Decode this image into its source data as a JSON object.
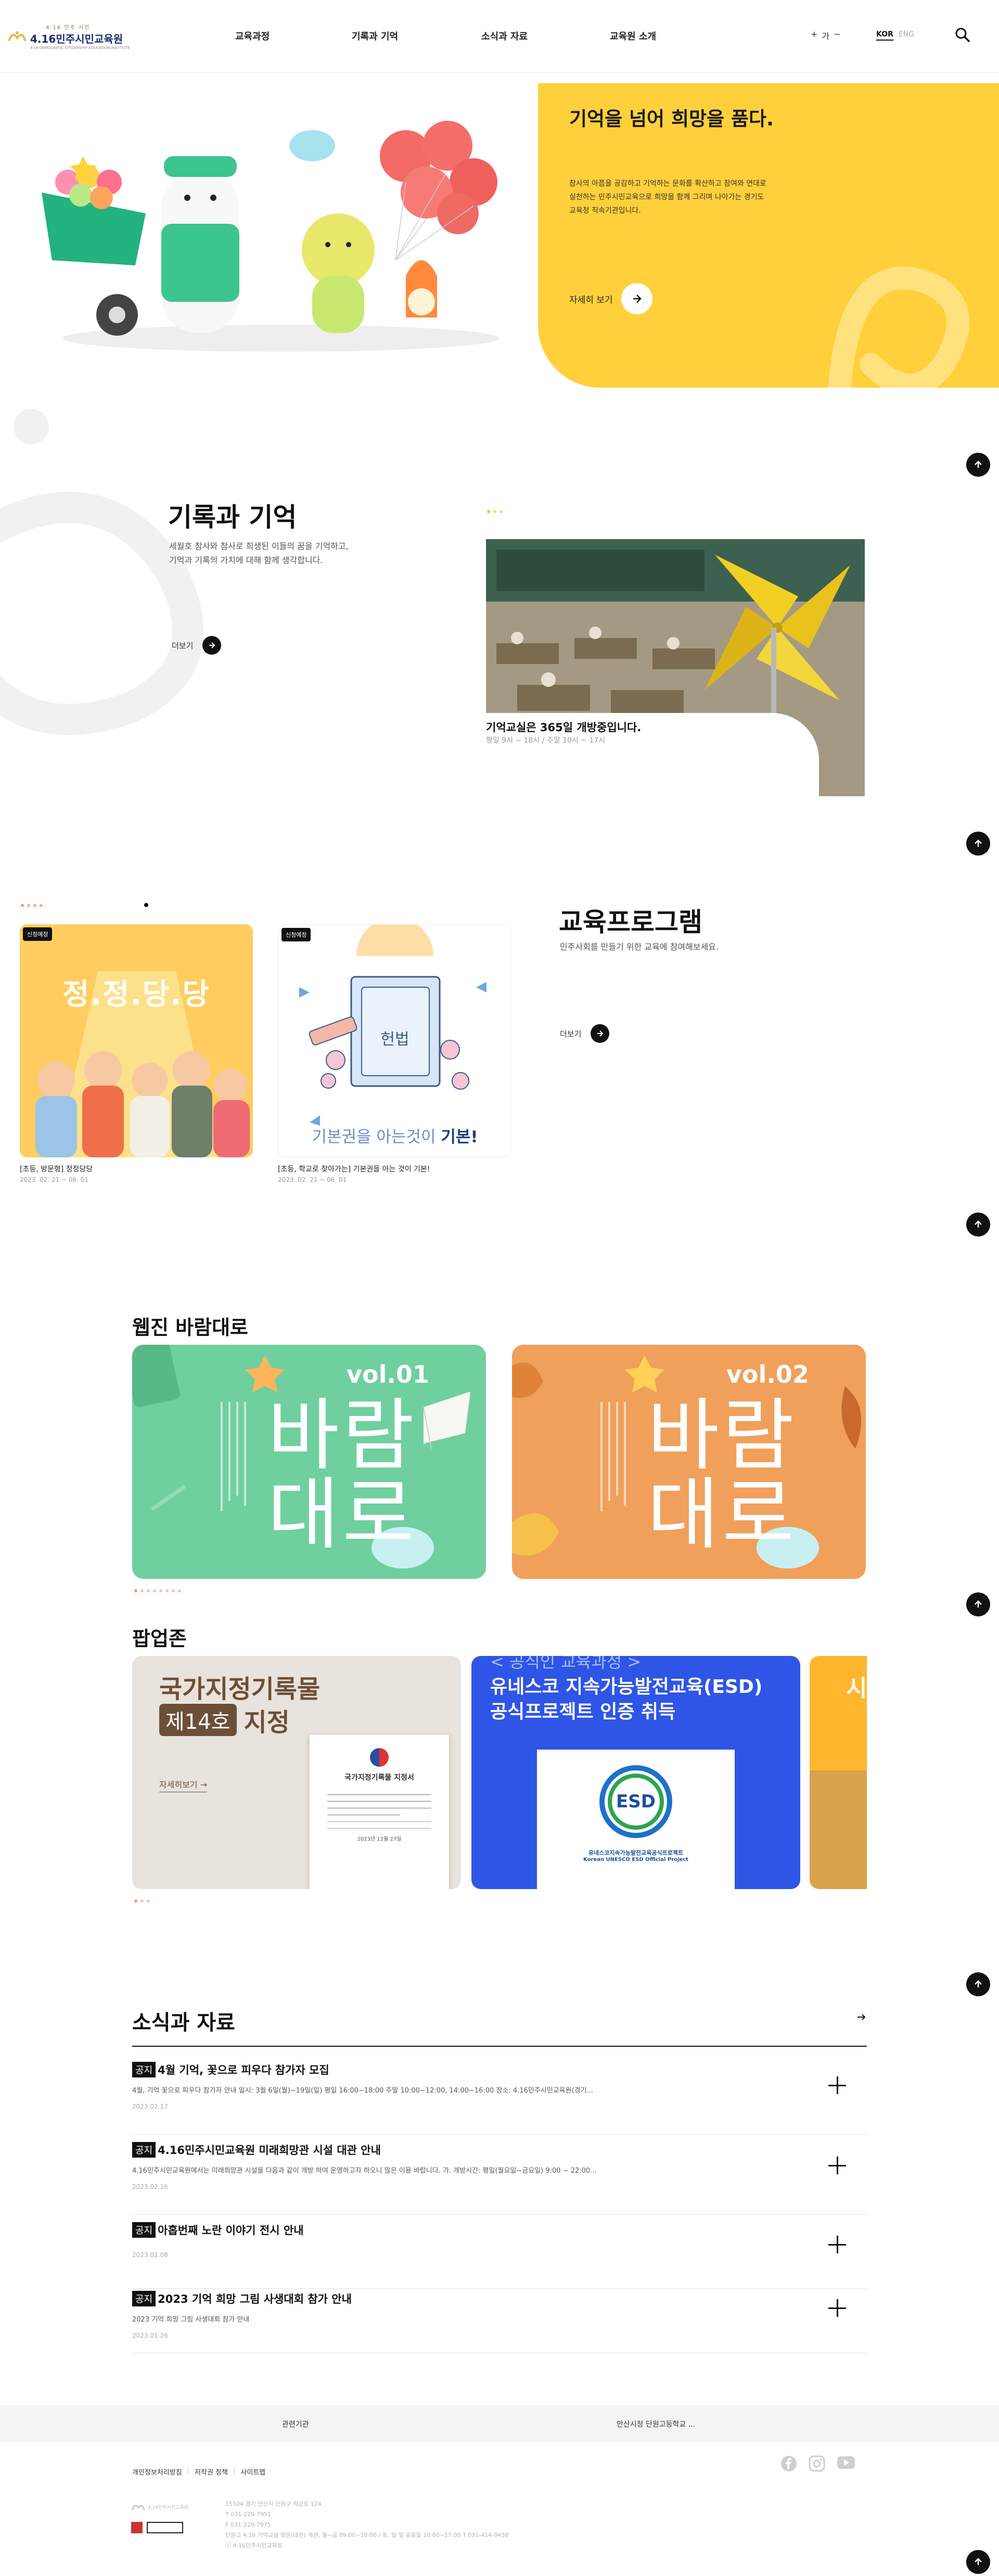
{
  "header": {
    "logo_sub": "4·16 민주 시민",
    "logo_main": "4.16민주시민교육원",
    "logo_en": "4.16 DEMOCRATIC CITIZENSHIP EDUCATION INSTITUTE",
    "nav": [
      "교육과정",
      "기록과 기억",
      "소식과 자료",
      "교육원 소개"
    ],
    "font_plus": "+",
    "font_label": "가",
    "font_minus": "−",
    "lang_kor": "KOR",
    "lang_eng": "ENG"
  },
  "hero": {
    "title": "기억을 넘어 희망을 품다.",
    "desc": "참사의 아픔을 공감하고 기억하는 문화를 확산하고 참여와 연대로 실천하는 민주시민교육으로 희망을 함께 그리며 나아가는 경기도교육청 직속기관입니다.",
    "more": "자세히 보기"
  },
  "memory": {
    "title": "기록과 기억",
    "desc1": "세월호 참사와 참사로 희생된 이들의 꿈을 기억하고,",
    "desc2": "기억과 기록의 가치에 대해 함께 생각합니다.",
    "more": "더보기",
    "caption_title": "기억교실은 365일 개방중입니다.",
    "caption_sub": "평일 9시 ~ 18시 / 주말 10시 ~ 17시"
  },
  "program": {
    "title": "교육프로그램",
    "desc": "민주사회를 만들기 위한 교육에 참여해보세요.",
    "more": "더보기",
    "cards": [
      {
        "badge": "신청예정",
        "art_title": "정.정.당.당",
        "title": "[초등, 방문형] 정정당당",
        "date": "2023. 02. 21 ~ 06. 01"
      },
      {
        "badge": "신청예정",
        "art_book": "헌법",
        "art_line": "기본권을 아는것이",
        "art_strong": "기본!",
        "title": "[초등, 학교로 찾아가는] 기본권을 아는 것이 기본!",
        "date": "2023. 02. 21 ~ 06. 01"
      }
    ]
  },
  "webzine": {
    "title": "웹진 바람대로",
    "cards": [
      {
        "vol": "vol.01",
        "line1": "바람",
        "line2": "대로",
        "color": "#6fcf9f"
      },
      {
        "vol": "vol.02",
        "line1": "바람",
        "line2": "대로",
        "color": "#f0a05a"
      }
    ]
  },
  "popup": {
    "title": "팝업존",
    "card1": {
      "line1": "국가지정기록물",
      "box": "제14호",
      "line2": "지정",
      "more": "자세히보기",
      "doc_title": "국가지정기록물 지정서",
      "doc_date": "2023년 12월 27일"
    },
    "card2": {
      "line0": "< 공식인 교육과정 >",
      "line1": "유네스코 지속가능발전교육(ESD)",
      "line2": "공식프로젝트 인증 취득",
      "esd": "ESD",
      "cert1": "유네스코지속가능발전교육공식프로젝트",
      "cert2": "Korean UNESCO ESD Official Project"
    },
    "card3": {
      "text": "시"
    }
  },
  "news": {
    "title": "소식과 자료",
    "items": [
      {
        "tag": "공지",
        "title": "4월 기억, 꽃으로 피우다 참가자 모집",
        "desc": "4월, 기억 꽃으로 피우다 참가자 안내 일시: 3월 6일(월)~19일(일)          평일 16:00~18:00          주말 10:00~12:00, 14:00~16:00 장소: 4.16민주시민교육원(경기...",
        "date": "2023.02.17"
      },
      {
        "tag": "공지",
        "title": "4.16민주시민교육원 미래희망관 시설 대관 안내",
        "desc": "4.16민주시민교육원에서는 미래희망관 시설을 다음과 같이 개방 하여 운영하고자 하오니 많은 이용 바랍니다. 가. 개방시간: 평일(월요일~금요일) 9:00 ~ 22:00...",
        "date": "2023.02.16"
      },
      {
        "tag": "공지",
        "title": "아홉번째 노란 이야기 전시 안내",
        "desc": "",
        "date": "2023.02.08"
      },
      {
        "tag": "공지",
        "title": "2023 기억 희망 그림 사생대회 참가 안내",
        "desc": "2023 기억 희망 그림 사생대회 참가 안내",
        "date": "2023.01.26"
      }
    ]
  },
  "footer": {
    "related": "관련기관",
    "school": "안산시청 단원고등학교 ...",
    "links": [
      "개인정보처리방침",
      "저작권 정책",
      "사이트맵"
    ],
    "info": [
      "15504 경기 안산시 단원구 적금로 124",
      "T 031-229-7951",
      "F 031-229-7975",
      "단원고 4.16 기억교실 방문(대관) 개관, 월~금 09:00~18:00 / 토, 일 및 공휴일 10:00~17:00 T 031-414-9458",
      "ⓒ 4.16민주시민교육원"
    ],
    "logo_text": "4.16민주시민교육원"
  },
  "colors": {
    "yellow": "#ffd03b",
    "dark": "#111111",
    "webzine_green": "#6fcf9f",
    "webzine_orange": "#f0a05a",
    "popup_blue": "#2f55e6"
  }
}
